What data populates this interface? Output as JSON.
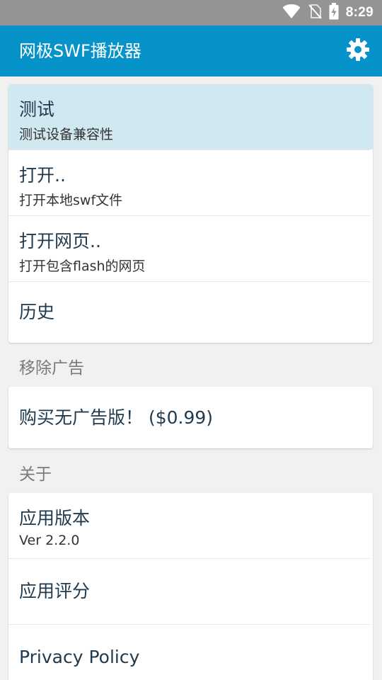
{
  "status_bar": {
    "time": "8:29",
    "icons": [
      "wifi-icon",
      "no-sim-icon",
      "battery-charging-icon"
    ]
  },
  "app_bar": {
    "title": "网极SWF播放器",
    "settings_icon": "gear-icon"
  },
  "colors": {
    "app_bar": "#0693c9",
    "status_bar": "#949494",
    "selected_row": "#d0e8f0",
    "background": "#f1f1f1"
  },
  "main_card": {
    "items": [
      {
        "title": "测试",
        "subtitle": "测试设备兼容性"
      },
      {
        "title": "打开..",
        "subtitle": "打开本地swf文件"
      },
      {
        "title": "打开网页..",
        "subtitle": "打开包含flash的网页"
      },
      {
        "title": "历史"
      }
    ]
  },
  "ads_section": {
    "header": "移除广告",
    "items": [
      {
        "title": "购买无广告版！ ($0.99)"
      }
    ]
  },
  "about_section": {
    "header": "关于",
    "items": [
      {
        "title": "应用版本",
        "subtitle": "Ver 2.2.0"
      },
      {
        "title": "应用评分"
      },
      {
        "title": "Privacy Policy"
      }
    ]
  }
}
